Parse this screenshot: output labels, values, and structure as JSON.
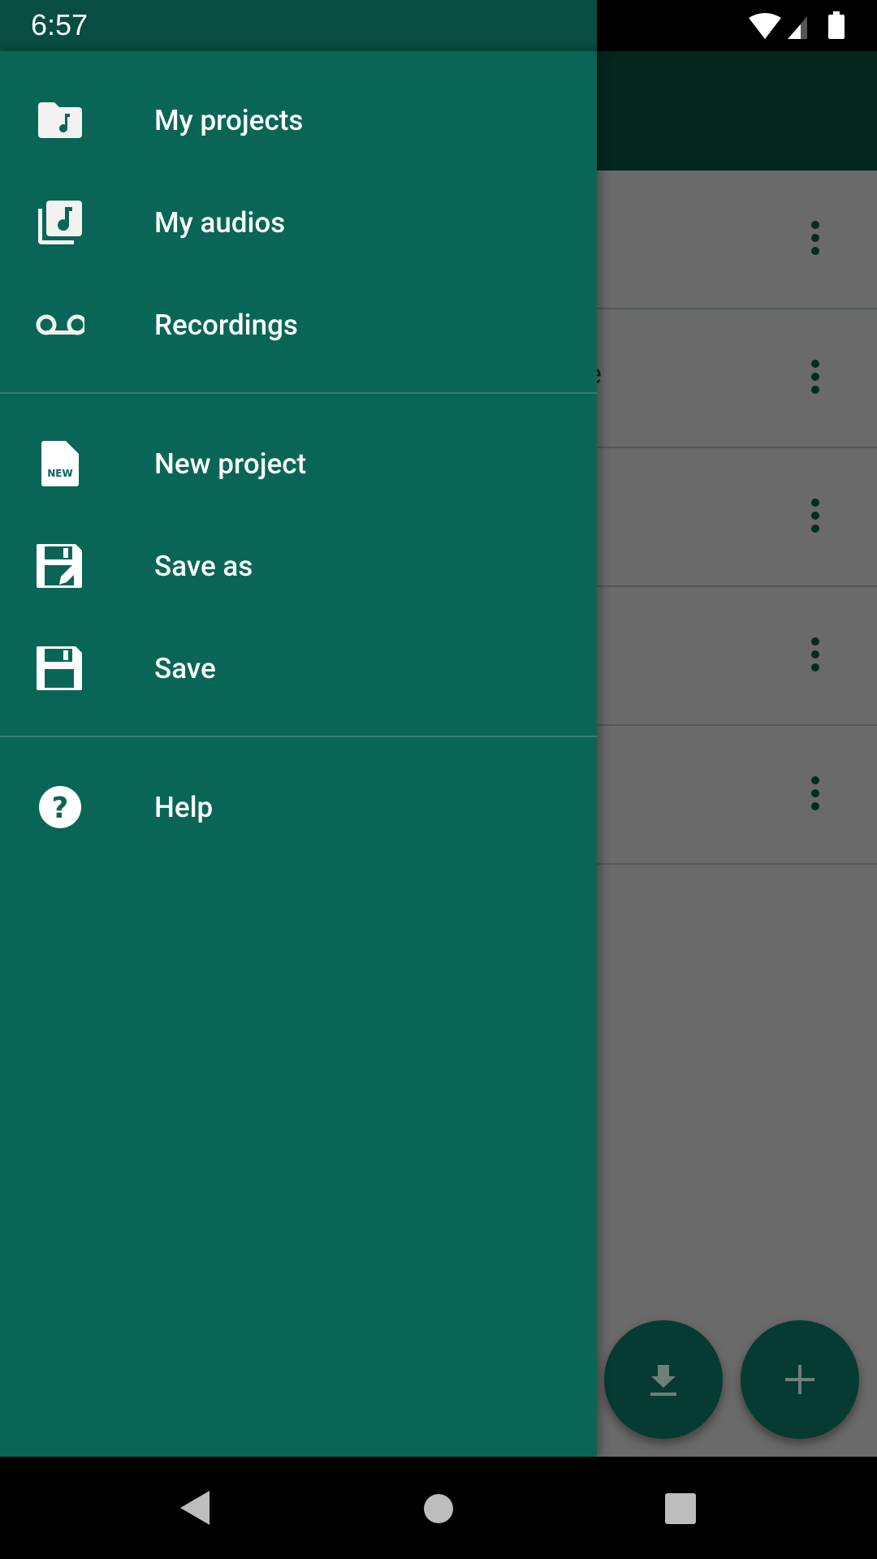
{
  "status_bar": {
    "time": "6:57",
    "icons": [
      "wifi-icon",
      "signal-icon",
      "battery-icon"
    ]
  },
  "drawer": {
    "groups": [
      [
        {
          "label": "My projects",
          "icon": "folder-music-icon"
        },
        {
          "label": "My audios",
          "icon": "library-music-icon"
        },
        {
          "label": "Recordings",
          "icon": "voicemail-icon"
        }
      ],
      [
        {
          "label": "New project",
          "icon": "new-file-icon"
        },
        {
          "label": "Save as",
          "icon": "save-edit-icon"
        },
        {
          "label": "Save",
          "icon": "save-icon"
        }
      ],
      [
        {
          "label": "Help",
          "icon": "help-circle-icon"
        }
      ]
    ],
    "new_badge": "NEW"
  },
  "background": {
    "partial_text": "e",
    "fabs": [
      "download-icon",
      "add-icon"
    ]
  },
  "colors": {
    "drawer": "#096657",
    "status": "#084d42",
    "toolbar": "#03261f",
    "fab": "#053b32"
  }
}
